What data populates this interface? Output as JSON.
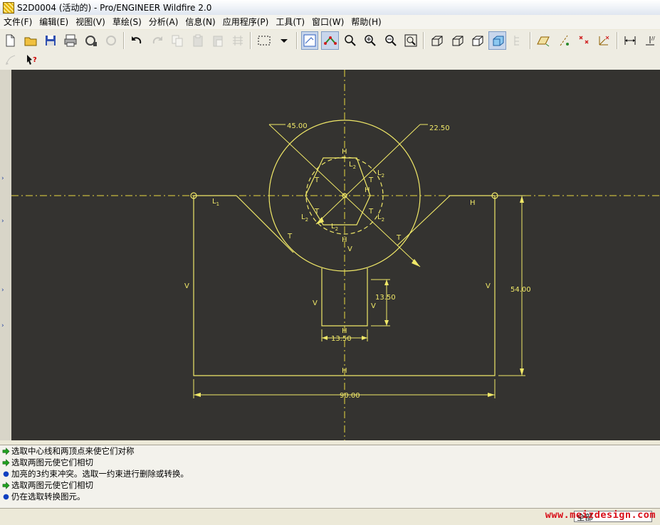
{
  "window": {
    "title": "S2D0004 (活动的) - Pro/ENGINEER Wildfire 2.0"
  },
  "menu": [
    {
      "label": "文件(F)"
    },
    {
      "label": "编辑(E)"
    },
    {
      "label": "视图(V)"
    },
    {
      "label": "草绘(S)"
    },
    {
      "label": "分析(A)"
    },
    {
      "label": "信息(N)"
    },
    {
      "label": "应用程序(P)"
    },
    {
      "label": "工具(T)"
    },
    {
      "label": "窗口(W)"
    },
    {
      "label": "帮助(H)"
    }
  ],
  "toolbar_icons": [
    "new-file-icon",
    "open-folder-icon",
    "save-icon",
    "print-icon",
    "save-copy-icon",
    "erase-icon",
    "undo-icon",
    "redo-icon",
    "copy-icon",
    "paste-icon",
    "paste-special-icon",
    "regenerate-icon",
    "select-box-icon",
    "dropdown-arrow-icon",
    "sketcher-icon",
    "constraint-icon",
    "repaint-icon",
    "zoom-in-icon",
    "zoom-out-icon",
    "refit-icon",
    "wireframe-icon",
    "hidden-line-icon",
    "no-hidden-icon",
    "shading-icon",
    "model-tree-icon",
    "datum-plane-icon",
    "datum-axis-icon",
    "datum-point-icon",
    "coordinate-system-icon",
    "dimension-display-icon",
    "constraint-display-icon"
  ],
  "toolbar2_icons": [
    "sketch-tool-icon",
    "whats-this-help-icon"
  ],
  "sketch": {
    "dimensions": {
      "outer_circle_dia": "45.00",
      "hex_dia": "22.50",
      "slot_depth": "13.50",
      "slot_width": "13.50",
      "height": "54.00",
      "width": "90.00"
    },
    "constraint_labels": {
      "horizontal": "H",
      "vertical": "V",
      "tangent": "T",
      "equal_length_prefix": "L",
      "equal_length_sub": "2",
      "line1_prefix": "L",
      "line1_sub": "1"
    },
    "colors": {
      "background": "#343330",
      "geometry": "#f0e868",
      "centerline": "#e8d840"
    }
  },
  "messages": [
    {
      "type": "prompt",
      "text": "选取中心线和两顶点来使它们对称"
    },
    {
      "type": "prompt",
      "text": "选取两图元使它们相切"
    },
    {
      "type": "info",
      "text": "加亮的3约束冲突。选取一约束进行删除或转换。"
    },
    {
      "type": "prompt",
      "text": "选取两图元使它们相切"
    },
    {
      "type": "info",
      "text": "仍在选取转换图元。"
    }
  ],
  "status": {
    "filter_value": "全部",
    "watermark": "www.meizdesign.com"
  }
}
